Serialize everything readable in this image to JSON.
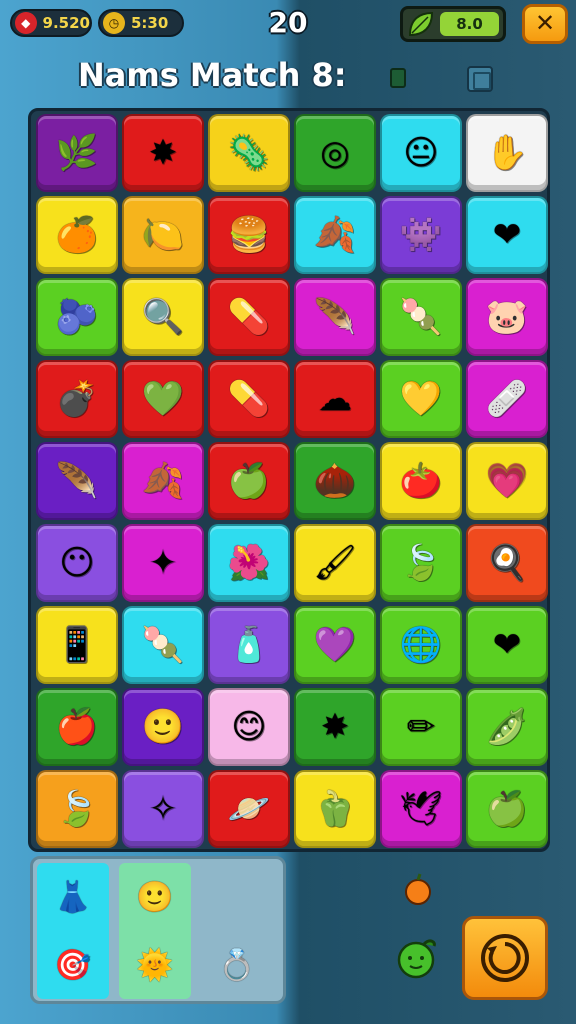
{
  "topbar": {
    "coins_label": "9.520",
    "coins_icon": "ruby-icon",
    "timer_label": "5:30",
    "timer_icon": "clock-icon",
    "score": "20",
    "energy_label": "8.0",
    "energy_icon": "leaf-icon",
    "close_label": "✕"
  },
  "title": "Nams Match 8:",
  "board": {
    "rows": [
      [
        {
          "name": "leaf-icon",
          "glyph": "🌿",
          "color": "#7b1fa2"
        },
        {
          "name": "burst-icon",
          "glyph": "✸",
          "color": "#e01b1b"
        },
        {
          "name": "virus-icon",
          "glyph": "🦠",
          "color": "#f6d21a"
        },
        {
          "name": "target-icon",
          "glyph": "◎",
          "color": "#2fa52a"
        },
        {
          "name": "face-icon",
          "glyph": "😐",
          "color": "#2fdcef"
        },
        {
          "name": "hand-icon",
          "glyph": "✋",
          "color": "#f4f4f4"
        }
      ],
      [
        {
          "name": "orange-icon",
          "glyph": "🍊",
          "color": "#f7e11c"
        },
        {
          "name": "lime-icon",
          "glyph": "🍋",
          "color": "#f6b41c"
        },
        {
          "name": "burger-icon",
          "glyph": "🍔",
          "color": "#e01b1b"
        },
        {
          "name": "leaf-icon",
          "glyph": "🍂",
          "color": "#2fdcef"
        },
        {
          "name": "monster-icon",
          "glyph": "👾",
          "color": "#7b3cd6"
        },
        {
          "name": "heart-icon",
          "glyph": "❤",
          "color": "#2fdcef"
        }
      ],
      [
        {
          "name": "plum-icon",
          "glyph": "🫐",
          "color": "#5bd022"
        },
        {
          "name": "magnifier-icon",
          "glyph": "🔍",
          "color": "#f7e11c"
        },
        {
          "name": "pill-icon",
          "glyph": "💊",
          "color": "#e01b1b"
        },
        {
          "name": "feather-icon",
          "glyph": "🪶",
          "color": "#d920d0"
        },
        {
          "name": "popsicle-icon",
          "glyph": "🍡",
          "color": "#5bd022"
        },
        {
          "name": "pig-icon",
          "glyph": "🐷",
          "color": "#d920d0"
        }
      ],
      [
        {
          "name": "bomb-icon",
          "glyph": "💣",
          "color": "#e01b1b"
        },
        {
          "name": "heart-icon",
          "glyph": "💚",
          "color": "#e01b1b"
        },
        {
          "name": "pill-icon",
          "glyph": "💊",
          "color": "#e01b1b"
        },
        {
          "name": "cloud-icon",
          "glyph": "☁",
          "color": "#e01b1b"
        },
        {
          "name": "heart-icon",
          "glyph": "💛",
          "color": "#5bd022"
        },
        {
          "name": "bandage-icon",
          "glyph": "🩹",
          "color": "#d920d0"
        }
      ],
      [
        {
          "name": "feather-icon",
          "glyph": "🪶",
          "color": "#6a1fc4"
        },
        {
          "name": "leaf-icon",
          "glyph": "🍂",
          "color": "#d920d0"
        },
        {
          "name": "apple-icon",
          "glyph": "🍏",
          "color": "#e01b1b"
        },
        {
          "name": "nut-icon",
          "glyph": "🌰",
          "color": "#2fa52a"
        },
        {
          "name": "tomato-icon",
          "glyph": "🍅",
          "color": "#f7e11c"
        },
        {
          "name": "heart-icon",
          "glyph": "💗",
          "color": "#f7e11c"
        }
      ],
      [
        {
          "name": "cloud-face-icon",
          "glyph": "😶",
          "color": "#8a4fe0"
        },
        {
          "name": "star-icon",
          "glyph": "✦",
          "color": "#d920d0"
        },
        {
          "name": "flower-icon",
          "glyph": "🌺",
          "color": "#2fdcef"
        },
        {
          "name": "paintbrush-icon",
          "glyph": "🖌",
          "color": "#f7e11c"
        },
        {
          "name": "leaf-icon",
          "glyph": "🍃",
          "color": "#5bd022"
        },
        {
          "name": "egg-icon",
          "glyph": "🍳",
          "color": "#f04a1e"
        }
      ],
      [
        {
          "name": "phone-icon",
          "glyph": "📱",
          "color": "#f7e11c"
        },
        {
          "name": "popsicle-icon",
          "glyph": "🍡",
          "color": "#2fdcef"
        },
        {
          "name": "bottle-icon",
          "glyph": "🧴",
          "color": "#8a4fe0"
        },
        {
          "name": "heart-icon",
          "glyph": "💜",
          "color": "#5bd022"
        },
        {
          "name": "globe-icon",
          "glyph": "🌐",
          "color": "#5bd022"
        },
        {
          "name": "heart-icon",
          "glyph": "❤",
          "color": "#5bd022"
        }
      ],
      [
        {
          "name": "apple-icon",
          "glyph": "🍎",
          "color": "#2fa52a"
        },
        {
          "name": "face-icon",
          "glyph": "🙂",
          "color": "#6a1fc4"
        },
        {
          "name": "smiley-icon",
          "glyph": "😊",
          "color": "#f7b8e8"
        },
        {
          "name": "starfish-icon",
          "glyph": "✸",
          "color": "#2fa52a"
        },
        {
          "name": "pencil-icon",
          "glyph": "✏",
          "color": "#5bd022"
        },
        {
          "name": "bean-icon",
          "glyph": "🫛",
          "color": "#5bd022"
        }
      ],
      [
        {
          "name": "leaf-icon",
          "glyph": "🍃",
          "color": "#f6a01c"
        },
        {
          "name": "sparkle-icon",
          "glyph": "✧",
          "color": "#8a4fe0"
        },
        {
          "name": "planet-icon",
          "glyph": "🪐",
          "color": "#e01b1b"
        },
        {
          "name": "pepper-icon",
          "glyph": "🫑",
          "color": "#f7e11c"
        },
        {
          "name": "bird-icon",
          "glyph": "🕊",
          "color": "#d920d0"
        },
        {
          "name": "apple-face-icon",
          "glyph": "🍏",
          "color": "#5bd022"
        }
      ]
    ]
  },
  "tray": {
    "columns": [
      {
        "color": "#2fdcef",
        "items": [
          {
            "name": "dress-icon",
            "glyph": "👗"
          },
          {
            "name": "target-icon",
            "glyph": "🎯"
          }
        ]
      },
      {
        "color": "#7de0a8",
        "items": [
          {
            "name": "smiley-icon",
            "glyph": "🙂"
          },
          {
            "name": "sun-icon",
            "glyph": "🌞"
          }
        ]
      },
      {
        "color": "#8fb7c9",
        "items": [
          {
            "name": "empty-slot",
            "glyph": ""
          },
          {
            "name": "ring-icon",
            "glyph": "💍"
          }
        ]
      }
    ]
  },
  "side": {
    "fruit1_icon": "orange-fruit-icon",
    "fruit2_icon": "green-fruit-icon",
    "spin_icon": "refresh-icon"
  }
}
